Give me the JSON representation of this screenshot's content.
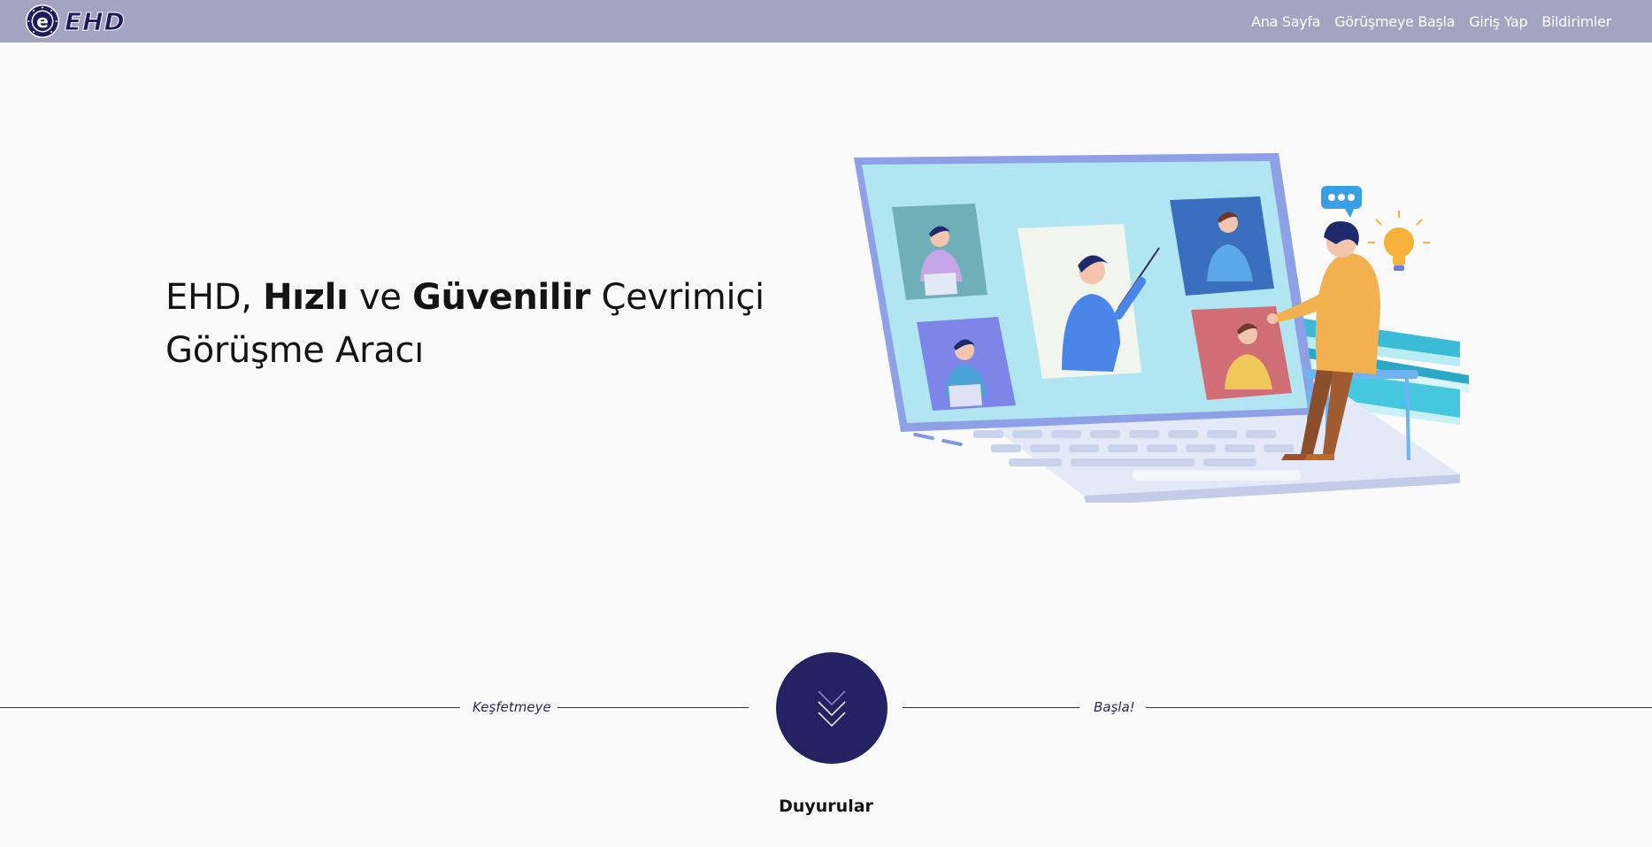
{
  "navbar": {
    "brand": "EHD",
    "links": [
      "Ana Sayfa",
      "Görüşmeye Başla",
      "Giriş Yap",
      "Bildirimler"
    ]
  },
  "hero": {
    "title_pre": "EHD, ",
    "title_bold1": "Hızlı",
    "title_mid": " ve ",
    "title_bold2": "Güvenilir",
    "title_post": " Çevrimiçi",
    "title_line2": "Görüşme Aracı"
  },
  "explore": {
    "left_label": "Keşfetmeye",
    "right_label": "Başla!"
  },
  "announcements": {
    "title": "Duyurular"
  },
  "colors": {
    "navbar_bg": "#a3a3c2",
    "accent_dark": "#242263",
    "page_bg": "#fafafa"
  },
  "icons": [
    "ehd-seal-icon",
    "chevron-double-down-icon"
  ]
}
